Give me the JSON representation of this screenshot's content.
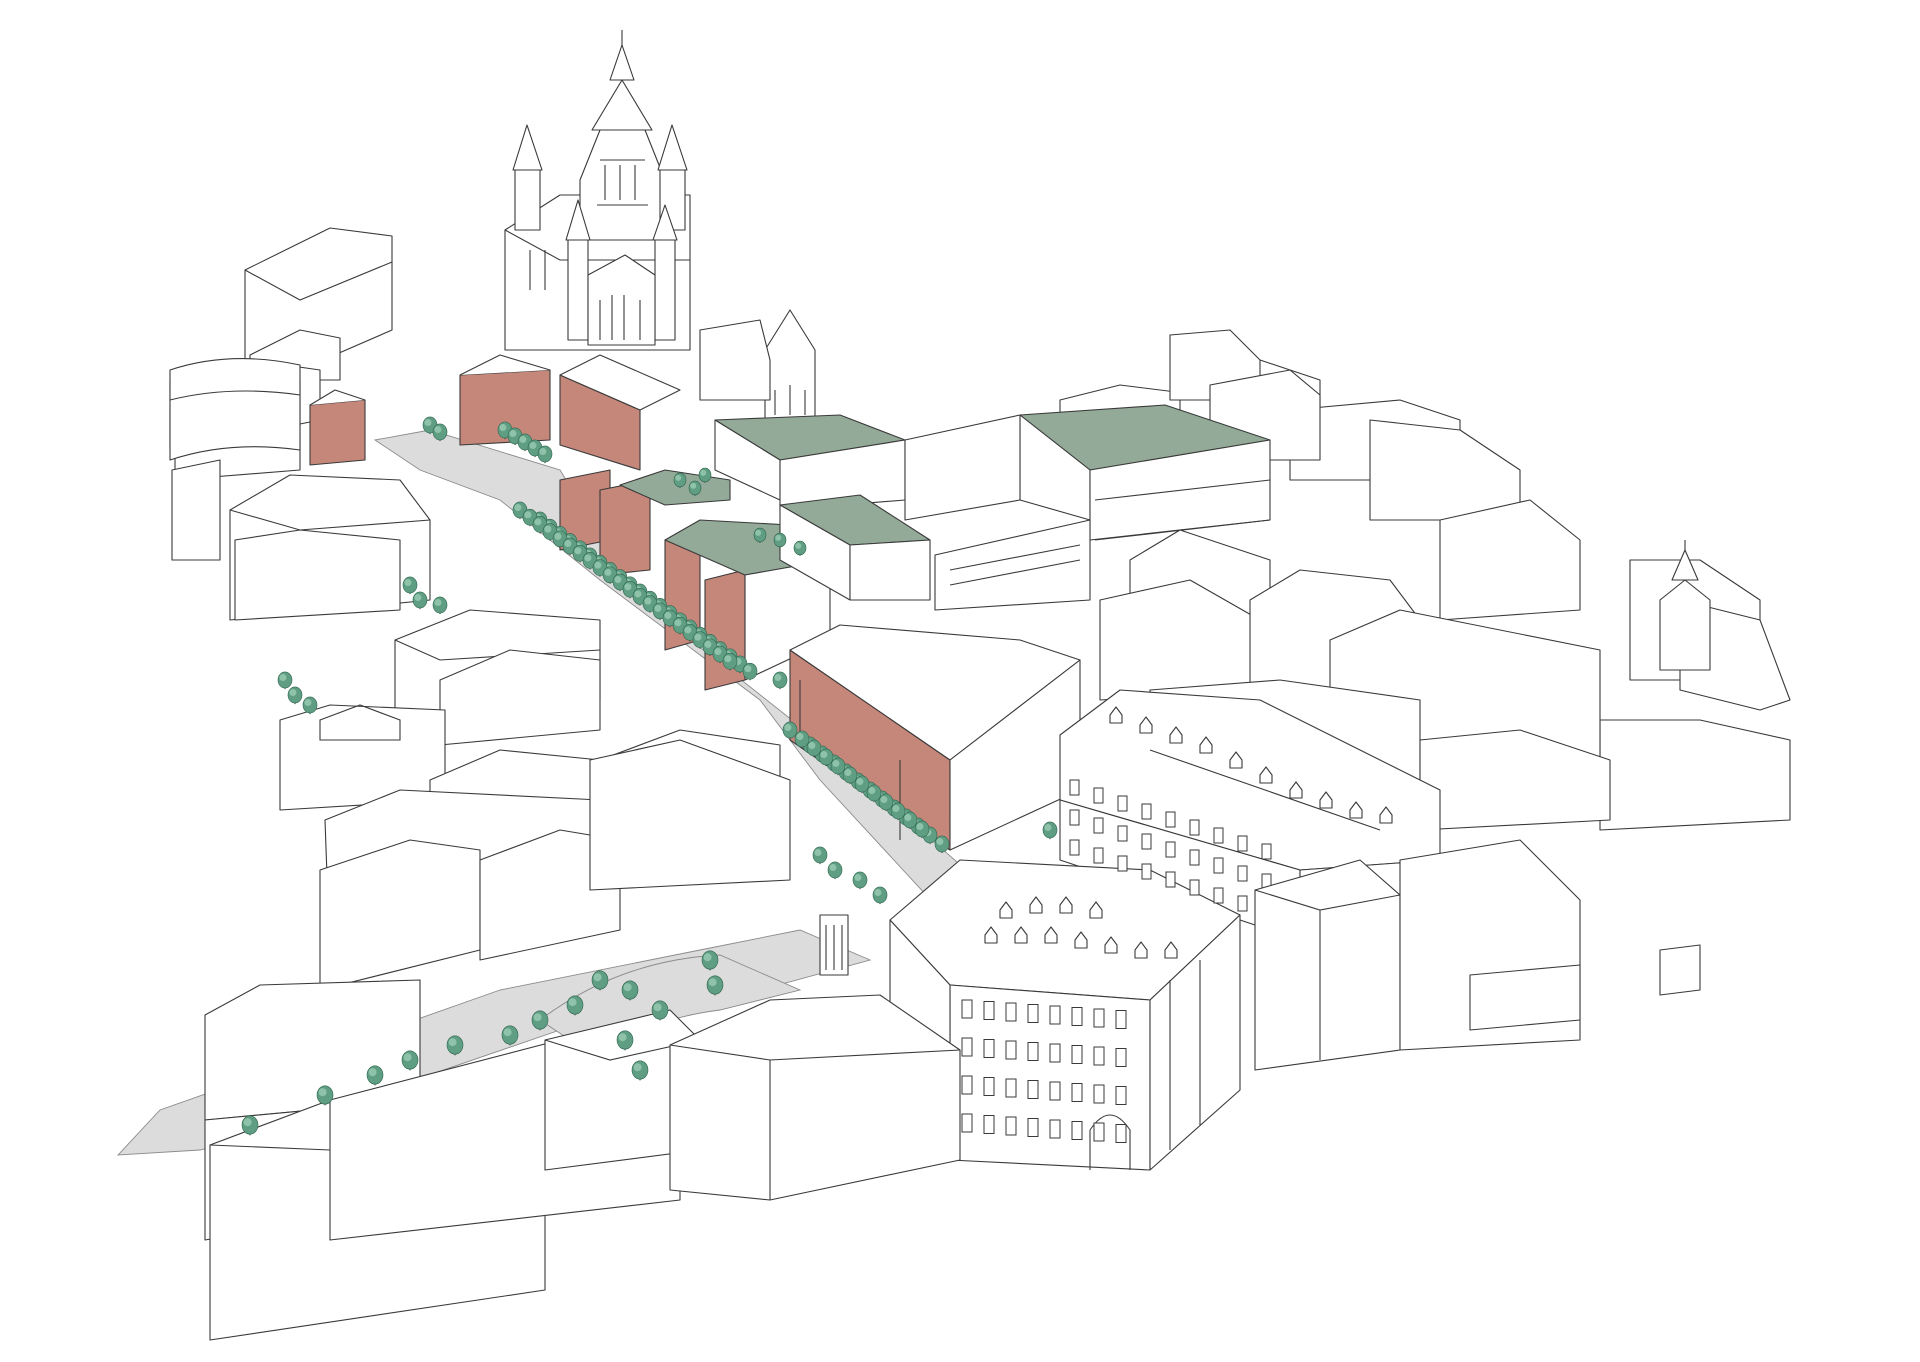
{
  "colors": {
    "background": "#ffffff",
    "outline": "#3a3a3a",
    "new_facade_brick": "#c4877a",
    "green_roof": "#93aa98",
    "street_paving": "#dcdcdc",
    "tree_canopy": "#5f9e82",
    "tree_canopy_light": "#8fc3a9",
    "tree_trunk": "#3a3a3a"
  },
  "icons": {
    "tree": "tree-icon"
  }
}
